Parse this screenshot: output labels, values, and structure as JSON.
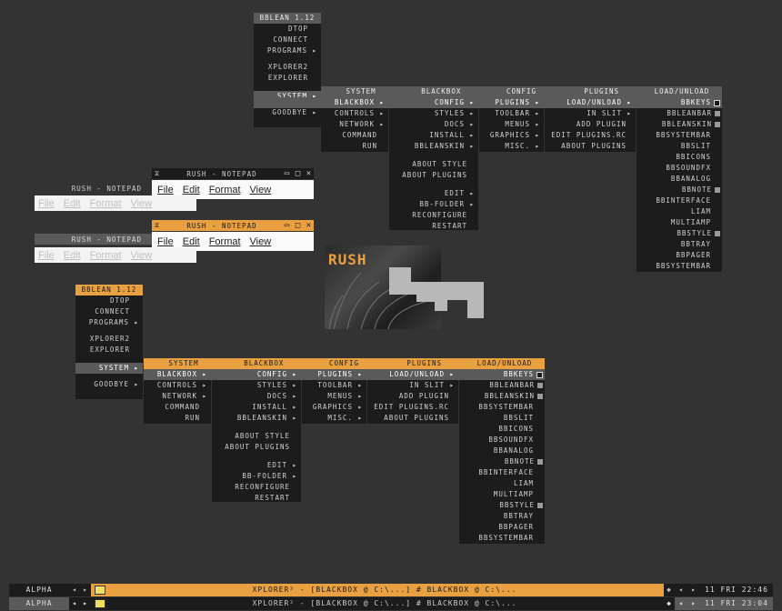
{
  "colors": {
    "accent": "#e8a040",
    "menu_bg": "#1c1c1c",
    "highlight_gray": "#5a5a5a",
    "desktop": "#333333"
  },
  "root_menu": {
    "title": "BBLEAN 1.12",
    "items": [
      "DTOP",
      "CONNECT",
      "PROGRAMS",
      "XPLORER2",
      "EXPLORER",
      "SYSTEM",
      "GOODBYE"
    ]
  },
  "submenus": {
    "headers": [
      "SYSTEM",
      "BLACKBOX",
      "CONFIG",
      "PLUGINS",
      "LOAD/UNLOAD"
    ],
    "system": [
      "BLACKBOX",
      "CONTROLS",
      "NETWORK",
      "COMMAND",
      "RUN"
    ],
    "blackbox": [
      "CONFIG",
      "STYLES",
      "DOCS",
      "INSTALL",
      "BBLEANSKIN",
      "ABOUT STYLE",
      "ABOUT PLUGINS",
      "EDIT",
      "BB-FOLDER",
      "RECONFIGURE",
      "RESTART"
    ],
    "config": [
      "PLUGINS",
      "TOOLBAR",
      "MENUS",
      "GRAPHICS",
      "MISC."
    ],
    "plugins": [
      "LOAD/UNLOAD",
      "IN SLIT",
      "ADD PLUGIN",
      "EDIT PLUGINS.RC",
      "ABOUT PLUGINS"
    ],
    "load_unload": [
      "BBKEYS",
      "BBLEANBAR",
      "BBLEANSKIN",
      "BBSYSTEMBAR",
      "BBSLIT",
      "BBICONS",
      "BBSOUNDFX",
      "BBANALOG",
      "BBNOTE",
      "BBINTERFACE",
      "LIAM",
      "MULTIAMP",
      "BBSTYLE",
      "BBTRAY",
      "BBPAGER",
      "BBSYSTEMBAR"
    ]
  },
  "notepad": {
    "title": "RUSH - NOTEPAD",
    "menu": [
      "File",
      "Edit",
      "Format",
      "View"
    ]
  },
  "preview_text": "RUSH",
  "taskbar": [
    {
      "workspace": "ALPHA",
      "task": "XPLORER² - [BLACKBOX @ C:\\...] # BLACKBOX @ C:\\...",
      "clock": "11 FRI 22:46"
    },
    {
      "workspace": "ALPHA",
      "task": "XPLORER² - [BLACKBOX @ C:\\...] # BLACKBOX @ C:\\...",
      "clock": "11 FRI 23:04"
    }
  ]
}
